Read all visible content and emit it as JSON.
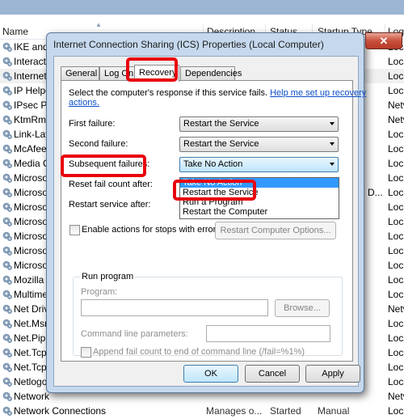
{
  "background_list": {
    "columns": [
      "Name",
      "Description",
      "Status",
      "Startup Type",
      "Log On As"
    ],
    "columns_visible": [
      "Name",
      "Description",
      "Status",
      "Startup Type",
      "Log"
    ],
    "rows": [
      {
        "name": "IKE and",
        "log": "Loca"
      },
      {
        "name": "Interacti",
        "log": "Loca"
      },
      {
        "name": "Internet",
        "log": "Loca"
      },
      {
        "name": "IP Helpe",
        "log": "Loca"
      },
      {
        "name": "IPsec Po",
        "log": "Netv"
      },
      {
        "name": "KtmRm",
        "log": "Netv"
      },
      {
        "name": "Link-Lay",
        "log": "Loca"
      },
      {
        "name": "McAfee",
        "log": "Loca"
      },
      {
        "name": "Media C",
        "log": "Loca"
      },
      {
        "name": "Microso",
        "log": "Loca"
      },
      {
        "name": "Microso",
        "extra": "D...",
        "log": "Loca"
      },
      {
        "name": "Microso",
        "log": "Loca"
      },
      {
        "name": "Microso",
        "log": "Loca"
      },
      {
        "name": "Microso",
        "log": "Loca"
      },
      {
        "name": "Microso",
        "log": "Loca"
      },
      {
        "name": "Microso",
        "log": "Loca"
      },
      {
        "name": "Mozilla",
        "log": "Loca"
      },
      {
        "name": "Multime",
        "log": "Loca"
      },
      {
        "name": "Net Driv",
        "log": "Netv"
      },
      {
        "name": "Net.Msn",
        "log": "Loca"
      },
      {
        "name": "Net.Pipe",
        "log": "Loca"
      },
      {
        "name": "Net.Tcp",
        "log": "Loca"
      },
      {
        "name": "Net.Tcp",
        "log": "Loca"
      },
      {
        "name": "Netlogo",
        "log": "Loca"
      },
      {
        "name": "Network",
        "log": "Netv"
      },
      {
        "name": "Network Connections",
        "description": "Manages o...",
        "status": "Started",
        "startup": "Manual",
        "log": "Loca"
      }
    ],
    "selected_row_index": 2
  },
  "dialog": {
    "title": "Internet Connection Sharing (ICS) Properties (Local Computer)",
    "close_label": "x",
    "tabs": [
      {
        "label": "General"
      },
      {
        "label": "Log On"
      },
      {
        "label": "Recovery",
        "active": true
      },
      {
        "label": "Dependencies"
      }
    ],
    "intro_text": "Select the computer's response if this service fails.",
    "help_link_line1": "Help me set up recovery",
    "help_link_line2": "actions.",
    "first_failure": {
      "label": "First failure:",
      "value": "Restart the Service"
    },
    "second_failure": {
      "label": "Second failure:",
      "value": "Restart the Service"
    },
    "subsequent_failures": {
      "label": "Subsequent failures:",
      "value": "Take No Action",
      "options": [
        "Take No Action",
        "Restart the Service",
        "Run a Program",
        "Restart the Computer"
      ],
      "highlighted_option": "Take No Action"
    },
    "reset_fail_count": {
      "label": "Reset fail count after:"
    },
    "restart_service_after": {
      "label": "Restart service after:"
    },
    "enable_actions_checkbox": {
      "label": "Enable actions for stops with errors.",
      "checked": false
    },
    "restart_computer_options_button": "Restart Computer Options...",
    "run_program": {
      "group_label": "Run program",
      "program_label": "Program:",
      "program_value": "",
      "browse_button": "Browse...",
      "cmdline_label": "Command line parameters:",
      "cmdline_value": "",
      "append_checkbox": {
        "label": "Append fail count to end of command line (/fail=%1%)",
        "checked": false
      }
    },
    "buttons": {
      "ok": "OK",
      "cancel": "Cancel",
      "apply": "Apply"
    }
  },
  "annotations": {
    "highlight_color": "#e8000b",
    "highlighted": [
      "Recovery tab",
      "Subsequent failures label",
      "Restart the Service option"
    ]
  }
}
